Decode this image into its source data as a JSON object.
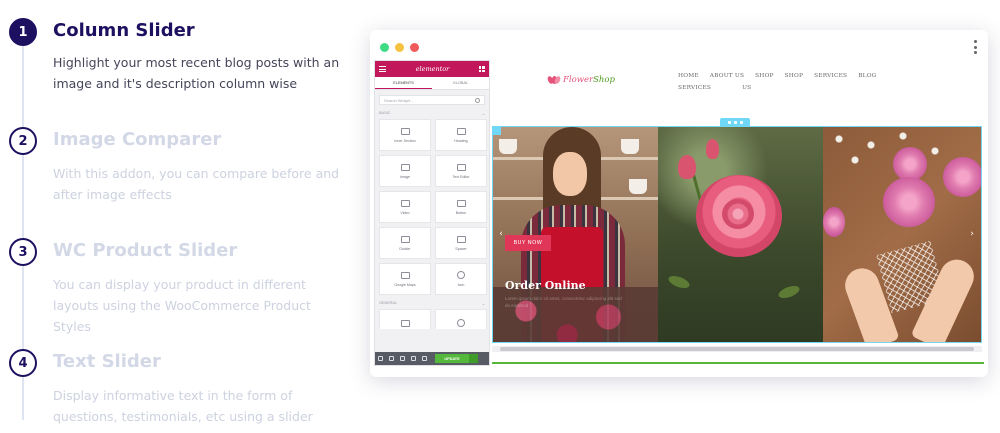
{
  "features": [
    {
      "number": "1",
      "title": "Column Slider",
      "description": "Highlight your most recent blog posts with an image and it's description column wise",
      "active": true
    },
    {
      "number": "2",
      "title": "Image Comparer",
      "description": "With this addon, you can compare before and after image effects",
      "active": false
    },
    {
      "number": "3",
      "title": "WC Product Slider",
      "description": "You can display your product in different layouts using the WooCommerce Product Styles",
      "active": false
    },
    {
      "number": "4",
      "title": "Text Slider",
      "description": "Display informative text in the form of questions, testimonials, etc using a slider",
      "active": false
    }
  ],
  "browser": {
    "dot_colors": [
      "#3ddc84",
      "#f6c242",
      "#f05a5a"
    ]
  },
  "editor": {
    "brand": "elementor",
    "tabs": [
      "ELEMENTS",
      "GLOBAL"
    ],
    "search_placeholder": "Search Widget...",
    "section_basic": "BASIC",
    "widgets": [
      "Inner Section",
      "Heading",
      "Image",
      "Text Editor",
      "Video",
      "Button",
      "Divider",
      "Spacer",
      "Google Maps",
      "Icon"
    ],
    "section_general": "GENERAL",
    "update_label": "UPDATE"
  },
  "site": {
    "logo_text_1": "Flower",
    "logo_text_2": "Shop",
    "nav": [
      "HOME",
      "ABOUT US",
      "SHOP",
      "SHOP",
      "SERVICES",
      "BLOG",
      "SERVICES",
      "US"
    ],
    "buy_now": "BUY NOW",
    "slide_title": "Order Online",
    "slide_subtitle": "Lorem ipsum dolor sit amet, consectetur adipiscing elit sed do eiusmod",
    "accent": "#e03657",
    "selection_color": "#71d7f7"
  }
}
